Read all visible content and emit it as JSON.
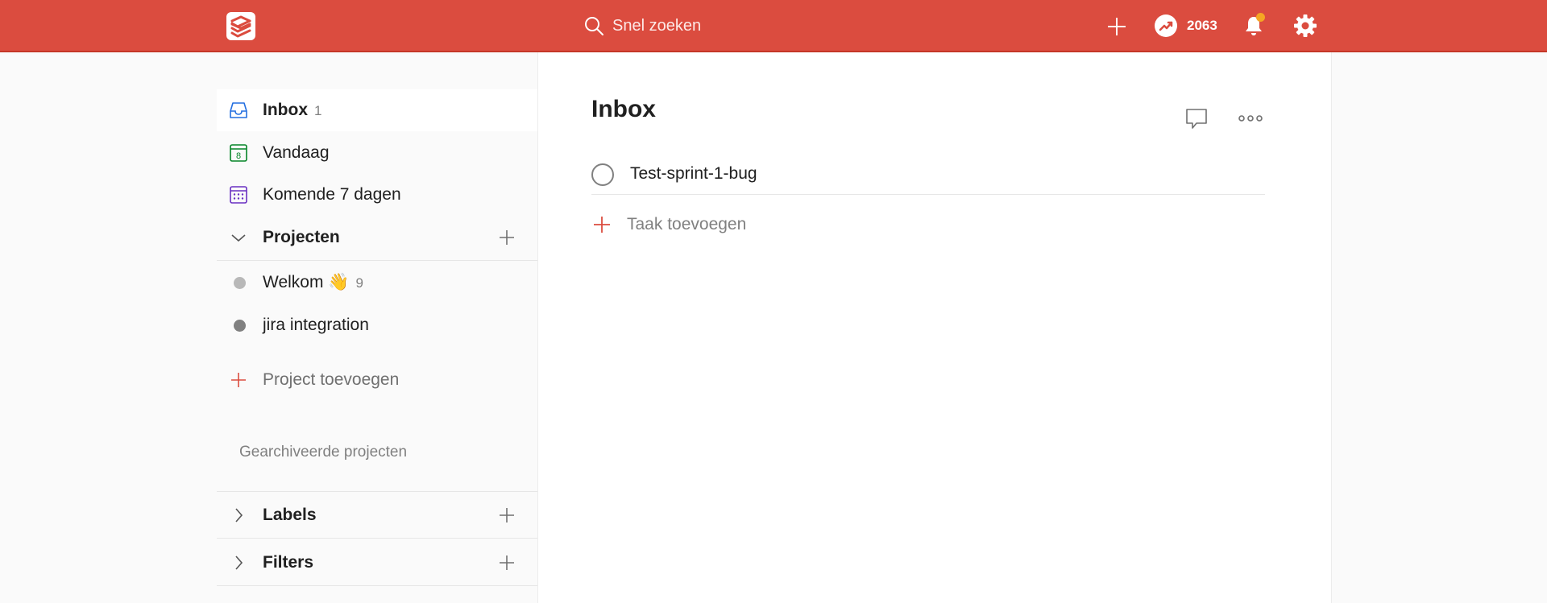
{
  "topbar": {
    "search_placeholder": "Snel zoeken",
    "karma_count": "2063",
    "accent_color": "#db4c3f",
    "notification_dot_color": "#f5a623",
    "icons": [
      "todoist-logo-icon",
      "search-icon",
      "plus-icon",
      "karma-trend-icon",
      "bell-icon",
      "gear-icon"
    ]
  },
  "sidebar": {
    "inbox": {
      "label": "Inbox",
      "count": "1"
    },
    "today": {
      "label": "Vandaag",
      "day": "8"
    },
    "upcoming": {
      "label": "Komende 7 dagen"
    },
    "projects_header": "Projecten",
    "projects": [
      {
        "name": "Welkom 👋",
        "count": "9",
        "color": "#b8b8b8"
      },
      {
        "name": "jira integration",
        "count": "",
        "color": "#808080"
      }
    ],
    "add_project": "Project toevoegen",
    "archived": "Gearchiveerde projecten",
    "labels_header": "Labels",
    "filters_header": "Filters"
  },
  "main": {
    "title": "Inbox",
    "tasks": [
      {
        "text": "Test-sprint-1-bug"
      }
    ],
    "add_task": "Taak toevoegen"
  }
}
